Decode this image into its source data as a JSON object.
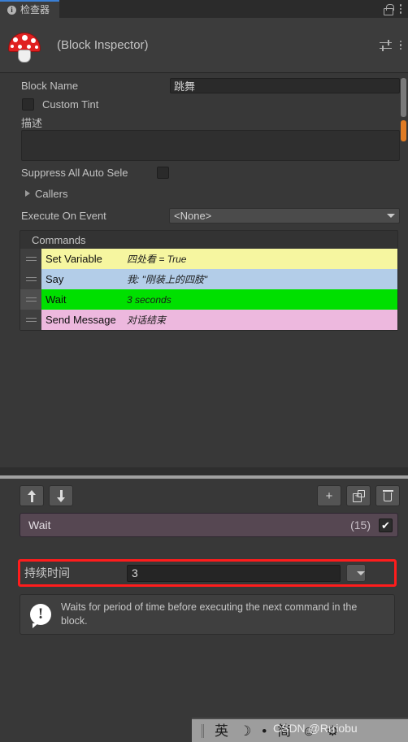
{
  "tab": {
    "label": "检查器",
    "info_icon": "info-icon",
    "lock_icon": "lock-icon",
    "menu_icon": "kebab-menu-icon"
  },
  "object_header": {
    "title": "(Block Inspector)",
    "logo_icon": "mushroom-icon",
    "settings_icon": "sliders-icon",
    "menu_icon": "kebab-menu-icon"
  },
  "inspector": {
    "block_name": {
      "label": "Block Name",
      "value": "跳舞"
    },
    "custom_tint": {
      "label": "Custom Tint",
      "checked": false
    },
    "description": {
      "label": "描述",
      "value": ""
    },
    "suppress": {
      "label": "Suppress All Auto Sele",
      "checked": false
    },
    "callers": {
      "label": "Callers",
      "expanded": false,
      "arrow_icon": "triangle-right-icon"
    },
    "execute_on_event": {
      "label": "Execute On Event",
      "value": "<None>",
      "arrow_icon": "chevron-down-icon"
    },
    "commands": {
      "header": "Commands",
      "rows": [
        {
          "type": "Set Variable",
          "summary": "四处看 = True",
          "color": "#f6f6a0",
          "selected": false
        },
        {
          "type": "Say",
          "summary": "我: \"刚装上的四肢\"",
          "color": "#b3cde8",
          "selected": false
        },
        {
          "type": "Wait",
          "summary": "3 seconds",
          "color": "#00e000",
          "selected": true
        },
        {
          "type": "Send Message",
          "summary": "对话结束",
          "color": "#edb8de",
          "selected": false
        }
      ]
    }
  },
  "command_editor": {
    "toolbar": {
      "move_up": "arrow-up-icon",
      "move_down": "arrow-down-icon",
      "add_label": "+",
      "duplicate": "duplicate-icon",
      "delete": "trash-icon"
    },
    "selected_command": {
      "name": "Wait",
      "count": "(15)",
      "enabled": true,
      "check_glyph": "✔"
    },
    "duration": {
      "label": "持续时间",
      "value": "3",
      "dropdown_icon": "chevron-down-icon"
    },
    "help": {
      "icon": "exclamation-icon",
      "text": "Waits for period of time before executing the next command in the block."
    }
  },
  "ime_bar": {
    "items": [
      "英",
      "☽",
      "•",
      "简",
      "☺",
      "⚙"
    ],
    "grip_icon": "drag-grip-icon",
    "watermark": "CSDN @Rrriobu"
  },
  "colors": {
    "panel_bg": "#383838",
    "header_bg": "#3c3c3c",
    "accent_blue": "#3a7fd5",
    "highlight_red": "#ff1c1c",
    "scroll_orange": "#e07b23",
    "selected_bar": "#564752"
  }
}
